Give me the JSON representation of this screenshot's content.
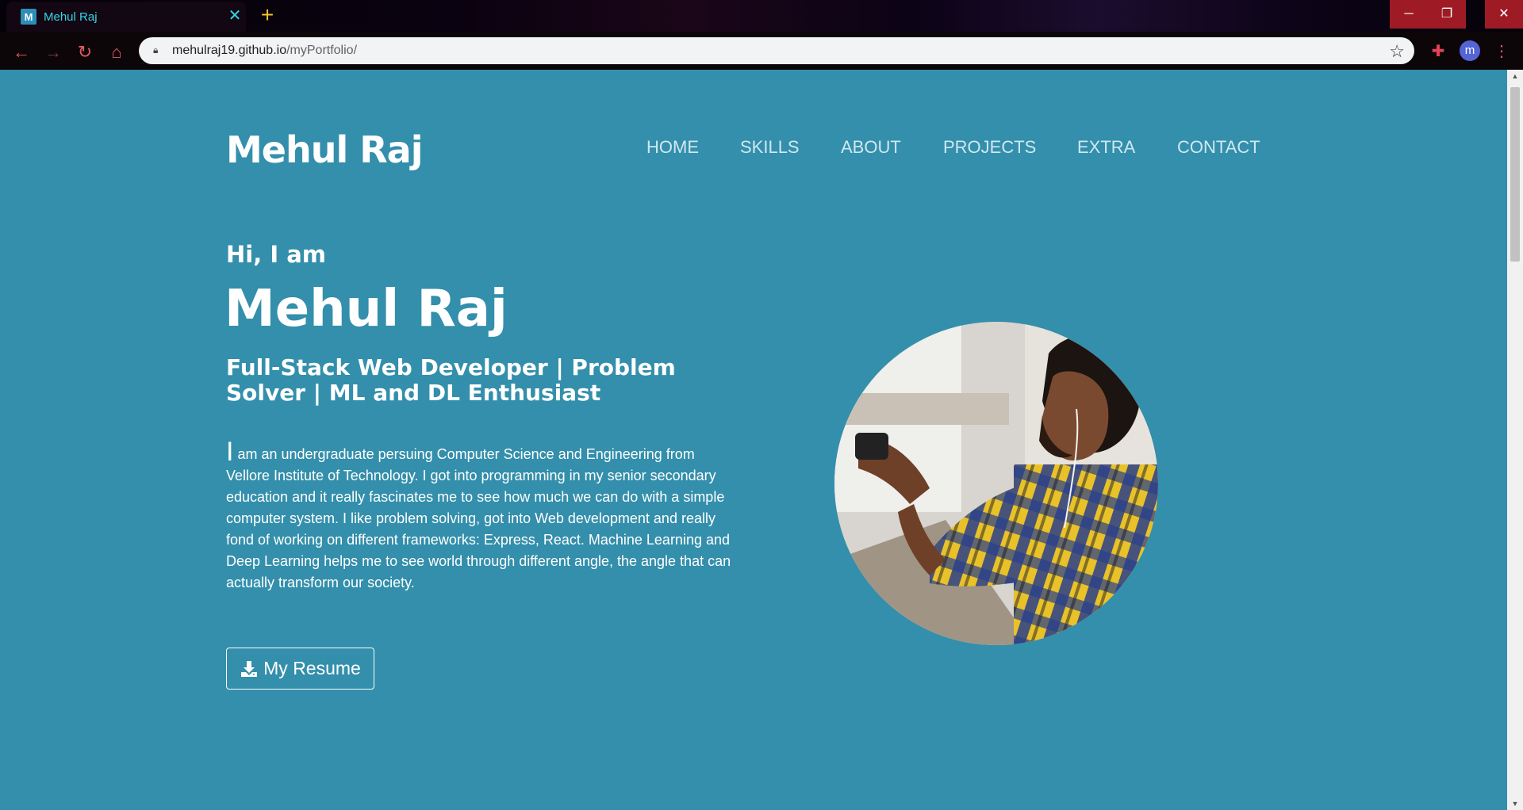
{
  "browser": {
    "tab_title": "Mehul Raj",
    "url_host": "mehulraj19.github.io",
    "url_path": "/myPortfolio/",
    "profile_initial": "m"
  },
  "site": {
    "logo": "Mehul Raj",
    "nav": [
      "HOME",
      "SKILLS",
      "ABOUT",
      "PROJECTS",
      "EXTRA",
      "CONTACT"
    ]
  },
  "hero": {
    "greeting": "Hi, I am",
    "name": "Mehul Raj",
    "role": "Full-Stack Web Developer | Problem Solver | ML and DL Enthusiast",
    "bio_initial": "I",
    "bio_rest": " am an undergraduate persuing Computer Science and Engineering from Vellore Institute of Technology. I got into programming in my senior secondary education and it really fascinates me to see how much we can do with a simple computer system. I like problem solving, got into Web development and really fond of working on different frameworks: Express, React. Machine Learning and Deep Learning helps me to see world through different angle, the angle that can actually transform our society.",
    "resume_button": "My Resume"
  },
  "colors": {
    "page_bg": "#338fab",
    "nav_text": "#cfe8f1",
    "tab_accent": "#33d8e8"
  }
}
